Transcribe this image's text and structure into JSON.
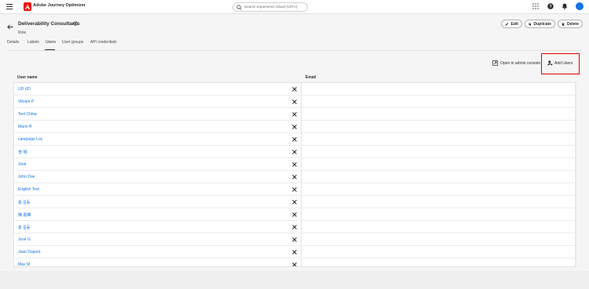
{
  "topbar": {
    "app_name": "Adobe Journey Optimizer",
    "search_placeholder": "Search Experience Cloud (Ctrl+/)"
  },
  "header": {
    "title": "Deliverability Consultants",
    "subtitle": "Role",
    "edit_label": "Edit",
    "duplicate_label": "Duplicate",
    "delete_label": "Delete"
  },
  "tabs": [
    {
      "label": "Details"
    },
    {
      "label": "Labels"
    },
    {
      "label": "Users"
    },
    {
      "label": "User groups"
    },
    {
      "label": "API credentials"
    }
  ],
  "actions": {
    "open_console_label": "Open in admin console",
    "add_users_label": "Add Users"
  },
  "table": {
    "columns": [
      "User name",
      "Email"
    ],
    "rows": [
      {
        "name": "UD UD"
      },
      {
        "name": "Vikram P"
      },
      {
        "name": "Test China"
      },
      {
        "name": "Mario R"
      },
      {
        "name": "campaign Loc"
      },
      {
        "name": "李 明"
      },
      {
        "name": "José"
      },
      {
        "name": "John Doe"
      },
      {
        "name": "English Test"
      },
      {
        "name": "홍 길동"
      },
      {
        "name": "陳 嘉暉"
      },
      {
        "name": "홍 길동"
      },
      {
        "name": "José G"
      },
      {
        "name": "Jean Dupont"
      },
      {
        "name": "Max M"
      }
    ]
  },
  "colors": {
    "accent": "#1473e6",
    "brand": "#eb1000",
    "highlight": "#e00000"
  }
}
